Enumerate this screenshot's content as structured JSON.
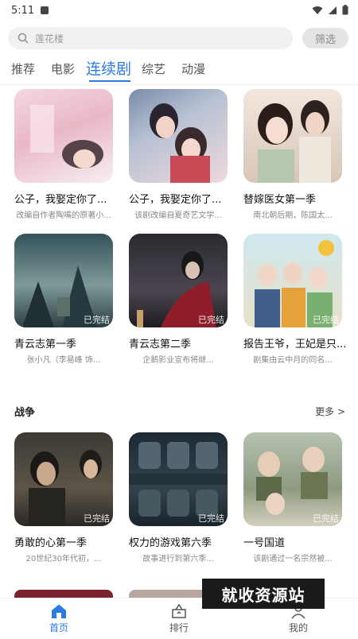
{
  "status_bar": {
    "time": "5:11"
  },
  "search": {
    "placeholder": "莲花楼",
    "filter_label": "筛选"
  },
  "tabs": [
    {
      "label": "推荐",
      "active": false
    },
    {
      "label": "电影",
      "active": false
    },
    {
      "label": "连续剧",
      "active": true
    },
    {
      "label": "综艺",
      "active": false
    },
    {
      "label": "动漫",
      "active": false
    }
  ],
  "accent_color": "#2c7be5",
  "grid": [
    {
      "title": "公子，我娶定你了...",
      "desc": "改编自作者陶嘴的原著小...",
      "badge": ""
    },
    {
      "title": "公子，我娶定你了...",
      "desc": "该剧改编自夏奇艺文学...",
      "badge": ""
    },
    {
      "title": "替嫁医女第一季",
      "desc": "南北朝后期，陈国太...",
      "badge": ""
    },
    {
      "title": "青云志第一季",
      "desc": "张小凡（李易峰 饰...",
      "badge": "已完结"
    },
    {
      "title": "青云志第二季",
      "desc": "企鹅影业宣布将继...",
      "badge": "已完结"
    },
    {
      "title": "报告王爷，王妃是只...",
      "desc": "剧集由云中月的同名...",
      "badge": "已完结"
    }
  ],
  "section": {
    "title": "战争",
    "more_label": "更多 >",
    "items": [
      {
        "title": "勇敢的心第一季",
        "desc": "20世纪30年代初，...",
        "badge": "已完结"
      },
      {
        "title": "权力的游戏第六季",
        "desc": "故事进行到第六季...",
        "badge": "已完结"
      },
      {
        "title": "一号国道",
        "desc": "该剧通过一名宗然被...",
        "badge": "已完结"
      }
    ]
  },
  "bottom_nav": [
    {
      "label": "首页",
      "active": true
    },
    {
      "label": "排行",
      "active": false
    },
    {
      "label": "我的",
      "active": false
    }
  ],
  "watermark": "就收资源站"
}
